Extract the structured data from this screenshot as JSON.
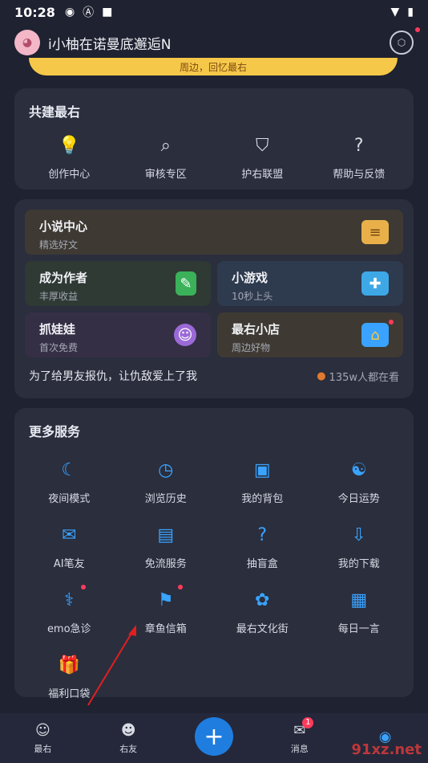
{
  "status": {
    "time": "10:28"
  },
  "header": {
    "username": "i小柚在诺曼底邂逅N"
  },
  "banner": {
    "text": "周边，回忆最右"
  },
  "community": {
    "title": "共建最右",
    "items": [
      {
        "label": "创作中心",
        "icon": "lightbulb-icon"
      },
      {
        "label": "审核专区",
        "icon": "review-search-icon"
      },
      {
        "label": "护右联盟",
        "icon": "shield-icon"
      },
      {
        "label": "帮助与反馈",
        "icon": "help-icon"
      }
    ]
  },
  "features": {
    "novel": {
      "title": "小说中心",
      "subtitle": "精选好文"
    },
    "author": {
      "title": "成为作者",
      "subtitle": "丰厚收益"
    },
    "game": {
      "title": "小游戏",
      "subtitle": "10秒上头"
    },
    "claw": {
      "title": "抓娃娃",
      "subtitle": "首次免费"
    },
    "shop": {
      "title": "最右小店",
      "subtitle": "周边好物"
    },
    "story": {
      "title": "为了给男友报仇，让仇敌爱上了我",
      "views": "135w人都在看"
    }
  },
  "services": {
    "title": "更多服务",
    "rows": [
      [
        {
          "label": "夜间模式",
          "icon": "moon-icon"
        },
        {
          "label": "浏览历史",
          "icon": "clock-icon"
        },
        {
          "label": "我的背包",
          "icon": "backpack-icon"
        },
        {
          "label": "今日运势",
          "icon": "yin-yang-icon"
        }
      ],
      [
        {
          "label": "AI笔友",
          "icon": "mail-icon"
        },
        {
          "label": "免流服务",
          "icon": "data-icon"
        },
        {
          "label": "抽盲盒",
          "icon": "mystery-box-icon"
        },
        {
          "label": "我的下载",
          "icon": "download-icon"
        }
      ],
      [
        {
          "label": "emo急诊",
          "icon": "stethoscope-icon"
        },
        {
          "label": "章鱼信箱",
          "icon": "mailbox-icon"
        },
        {
          "label": "最右文化街",
          "icon": "culture-icon"
        },
        {
          "label": "每日一言",
          "icon": "calendar-icon"
        }
      ],
      [
        {
          "label": "福利口袋",
          "icon": "gift-bag-icon"
        }
      ]
    ]
  },
  "nav": {
    "items": [
      {
        "label": "最右",
        "icon": "home-face-icon"
      },
      {
        "label": "右友",
        "icon": "friends-icon"
      },
      {
        "label": "",
        "icon": "plus-icon"
      },
      {
        "label": "消息",
        "icon": "message-icon",
        "badge": "1"
      },
      {
        "label": "",
        "icon": "profile-icon"
      }
    ]
  },
  "watermark": "91xz.net"
}
